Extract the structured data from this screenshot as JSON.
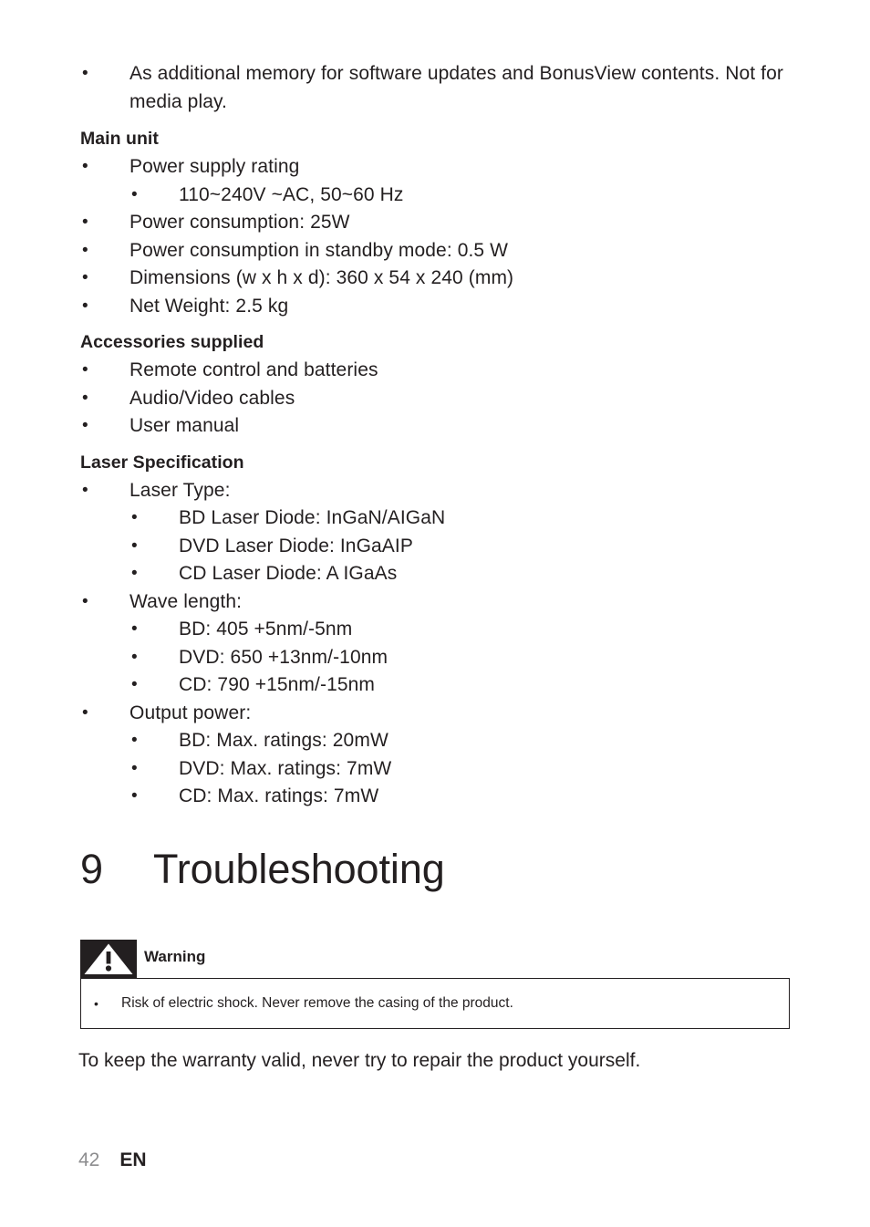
{
  "page": {
    "number": "42",
    "language": "EN"
  },
  "intro_bullets": [
    "As additional memory for software updates and BonusView contents. Not for media play."
  ],
  "sections": [
    {
      "heading": "Main unit",
      "items": [
        {
          "level": 1,
          "text": "Power supply rating"
        },
        {
          "level": 2,
          "text": "110~240V ~AC, 50~60 Hz"
        },
        {
          "level": 1,
          "text": "Power consumption: 25W"
        },
        {
          "level": 1,
          "text": "Power consumption in standby mode: 0.5 W"
        },
        {
          "level": 1,
          "text": "Dimensions (w x h x d): 360 x 54 x 240 (mm)"
        },
        {
          "level": 1,
          "text": "Net Weight: 2.5 kg"
        }
      ]
    },
    {
      "heading": "Accessories supplied",
      "items": [
        {
          "level": 1,
          "text": "Remote control and batteries"
        },
        {
          "level": 1,
          "text": "Audio/Video cables"
        },
        {
          "level": 1,
          "text": "User manual"
        }
      ]
    },
    {
      "heading": "Laser Specification",
      "items": [
        {
          "level": 1,
          "text": "Laser Type:"
        },
        {
          "level": 2,
          "text": "BD Laser Diode: InGaN/AIGaN"
        },
        {
          "level": 2,
          "text": "DVD Laser Diode: InGaAIP"
        },
        {
          "level": 2,
          "text": "CD Laser Diode: A IGaAs"
        },
        {
          "level": 1,
          "text": "Wave length:"
        },
        {
          "level": 2,
          "text": "BD: 405 +5nm/-5nm"
        },
        {
          "level": 2,
          "text": "DVD: 650 +13nm/-10nm"
        },
        {
          "level": 2,
          "text": "CD: 790 +15nm/-15nm"
        },
        {
          "level": 1,
          "text": "Output power:"
        },
        {
          "level": 2,
          "text": "BD: Max. ratings: 20mW"
        },
        {
          "level": 2,
          "text": "DVD: Max. ratings: 7mW"
        },
        {
          "level": 2,
          "text": "CD: Max. ratings: 7mW"
        }
      ]
    }
  ],
  "chapter": {
    "number": "9",
    "title": "Troubleshooting"
  },
  "warning": {
    "icon": "warning-triangle-icon",
    "title": "Warning",
    "items": [
      "Risk of electric shock. Never remove the casing of the product."
    ]
  },
  "paragraph": "To keep the warranty valid, never try to repair the product yourself.",
  "bullet_glyph": "•",
  "colors": {
    "text": "#231f20",
    "page_number": "#8d8d8f",
    "note_border": "#231f20",
    "icon_background": "#231f20"
  }
}
